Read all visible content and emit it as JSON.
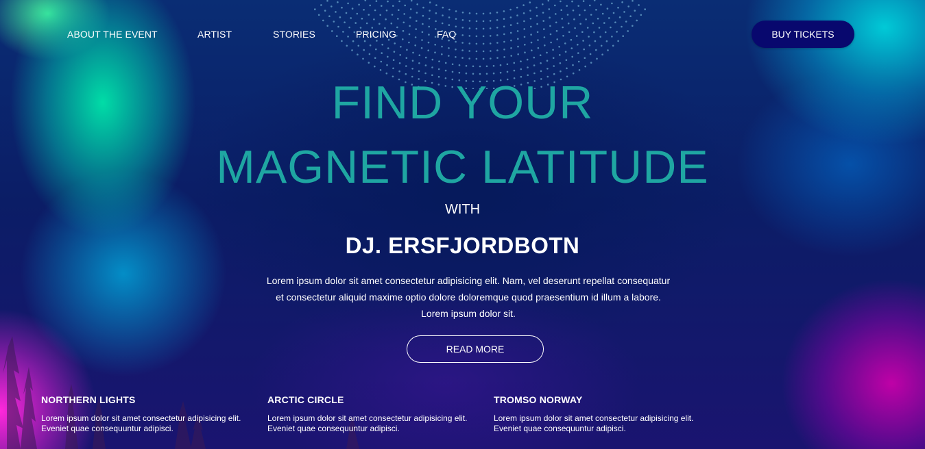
{
  "nav": {
    "items": [
      {
        "label": "ABOUT THE EVENT"
      },
      {
        "label": "ARTIST"
      },
      {
        "label": "STORIES"
      },
      {
        "label": "PRICING"
      },
      {
        "label": "FAQ"
      }
    ],
    "cta_label": "BUY TICKETS"
  },
  "hero": {
    "headline_line1": "FIND YOUR",
    "headline_line2": "MAGNETIC LATITUDE",
    "with": "WITH",
    "artist": "DJ. ERSFJORDBOTN",
    "description_lines": [
      "Lorem ipsum dolor sit amet consectetur adipisicing elit. Nam, vel deserunt repellat consequatur",
      "et consectetur aliquid maxime optio dolore doloremque quod praesentium id illum a labore.",
      "Lorem ipsum dolor sit."
    ],
    "read_more_label": "READ MORE"
  },
  "features": [
    {
      "title": "NORTHERN LIGHTS",
      "text_lines": [
        "Lorem ipsum dolor sit amet consectetur adipisicing elit.",
        "Eveniet quae consequuntur adipisci."
      ]
    },
    {
      "title": "ARCTIC CIRCLE",
      "text_lines": [
        "Lorem ipsum dolor sit amet consectetur adipisicing elit.",
        "Eveniet quae consequuntur adipisci."
      ]
    },
    {
      "title": "TROMSO NORWAY",
      "text_lines": [
        "Lorem ipsum dolor sit amet consectetur adipisicing elit.",
        "Eveniet quae consequuntur adipisci."
      ]
    }
  ],
  "colors": {
    "headline": "#1fa6a2",
    "cta_background": "#08086e",
    "text": "#ffffff"
  }
}
